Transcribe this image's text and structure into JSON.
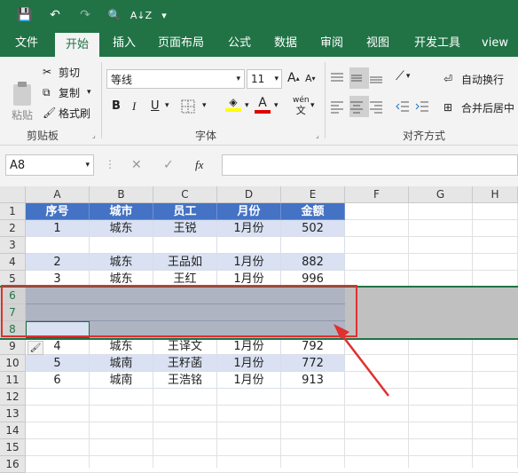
{
  "qat": {
    "save": "💾",
    "undo": "↶",
    "redo": "↷",
    "preview": "🔍",
    "sort": "A↓Z",
    "more": "▾"
  },
  "tabs": [
    "文件",
    "开始",
    "插入",
    "页面布局",
    "公式",
    "数据",
    "审阅",
    "视图",
    "开发工具",
    "view"
  ],
  "clipboard": {
    "paste": "粘贴",
    "cut": "剪切",
    "copy": "复制",
    "format_painter": "格式刷",
    "group": "剪贴板"
  },
  "font": {
    "name": "等线",
    "size": "11",
    "grow": "A",
    "shrink": "A",
    "bold": "B",
    "italic": "I",
    "underline": "U",
    "fill_letter": "A",
    "phonetic_top": "wén",
    "phonetic_bottom": "文",
    "group": "字体"
  },
  "alignment": {
    "wrap": "自动换行",
    "merge": "合并后居中",
    "group": "对齐方式"
  },
  "formula": {
    "name_box": "A8",
    "cancel": "✕",
    "confirm": "✓",
    "fx": "fx",
    "value": ""
  },
  "columns": [
    "A",
    "B",
    "C",
    "D",
    "E",
    "F",
    "G",
    "H"
  ],
  "rows": [
    "1",
    "2",
    "3",
    "4",
    "5",
    "6",
    "7",
    "8",
    "9",
    "10",
    "11",
    "12",
    "13",
    "14",
    "15",
    "16"
  ],
  "table": {
    "headers": [
      "序号",
      "城市",
      "员工",
      "月份",
      "金额"
    ],
    "rows": [
      [
        "1",
        "城东",
        "王锐",
        "1月份",
        "502"
      ],
      [
        "",
        "",
        "",
        "",
        ""
      ],
      [
        "2",
        "城东",
        "王品如",
        "1月份",
        "882"
      ],
      [
        "3",
        "城东",
        "王红",
        "1月份",
        "996"
      ],
      [
        "",
        "",
        "",
        "",
        ""
      ],
      [
        "",
        "",
        "",
        "",
        ""
      ],
      [
        "",
        "",
        "",
        "",
        ""
      ],
      [
        "4",
        "城东",
        "王译文",
        "1月份",
        "792"
      ],
      [
        "5",
        "城南",
        "王籽菡",
        "1月份",
        "772"
      ],
      [
        "6",
        "城南",
        "王浩铭",
        "1月份",
        "913"
      ]
    ]
  },
  "colors": {
    "excel_green": "#217346",
    "header_blue": "#4472c4",
    "band_light": "#d9e1f2",
    "insert_gray": "#c0c0c0",
    "highlight_red": "#e03030"
  }
}
